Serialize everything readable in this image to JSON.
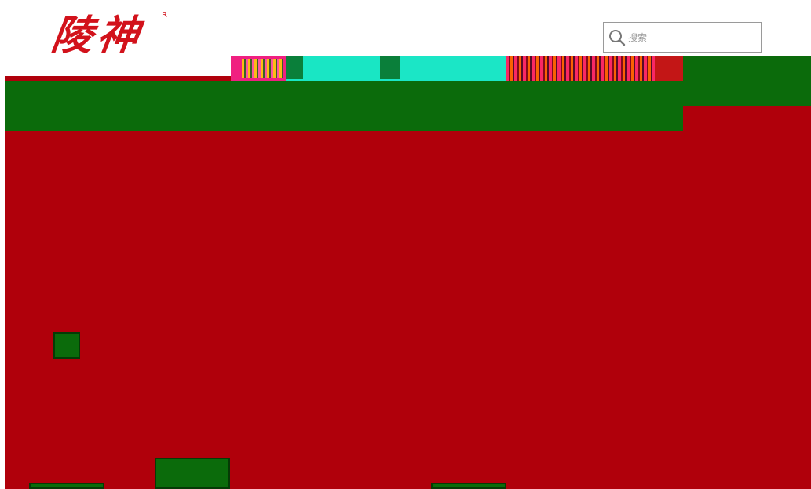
{
  "header": {
    "logo_text": "陵神",
    "logo_reg_mark": "R",
    "search": {
      "placeholder": "搜索",
      "value": ""
    }
  },
  "colors": {
    "brand_red": "#d2121b",
    "banner_red": "#b0000b",
    "nav_green": "#0b6b0b"
  },
  "icons": {
    "search": "search-icon"
  }
}
